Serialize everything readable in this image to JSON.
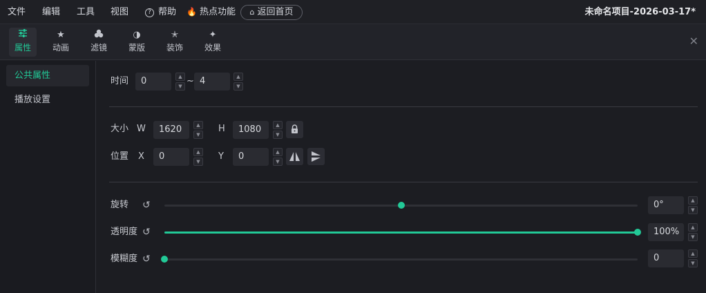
{
  "colors": {
    "accent": "#22c997",
    "background": "#1c1d22",
    "title_text": "#e6e7ea"
  },
  "menu": {
    "file": "文件",
    "edit": "编辑",
    "tools": "工具",
    "view": "视图",
    "help": "帮助",
    "hot_features": "热点功能",
    "home_button": "返回首页"
  },
  "project_title": "未命名项目-2026-03-17*",
  "tabs": [
    {
      "label": "属性",
      "icon": "sliders-icon",
      "active": true
    },
    {
      "label": "动画",
      "icon": "star-motion-icon"
    },
    {
      "label": "滤镜",
      "icon": "filter-circles-icon"
    },
    {
      "label": "蒙版",
      "icon": "mask-half-icon"
    },
    {
      "label": "装饰",
      "icon": "sparkle-star-icon"
    },
    {
      "label": "效果",
      "icon": "effects-sparkle-icon"
    }
  ],
  "sidebar": {
    "items": [
      {
        "label": "公共属性",
        "active": true
      },
      {
        "label": "播放设置"
      }
    ]
  },
  "time": {
    "label": "时间",
    "start": "0",
    "separator": "~",
    "end": "4"
  },
  "size": {
    "label": "大小",
    "w_label": "W",
    "w_value": "1620",
    "h_label": "H",
    "h_value": "1080",
    "lock_icon": "lock-icon"
  },
  "position": {
    "label": "位置",
    "x_label": "X",
    "x_value": "0",
    "y_label": "Y",
    "y_value": "0",
    "flip_h_icon": "flip-horizontal-icon",
    "flip_v_icon": "flip-vertical-icon"
  },
  "rotation": {
    "label": "旋转",
    "value_text": "0°",
    "value": 0,
    "min": -180,
    "max": 180
  },
  "opacity": {
    "label": "透明度",
    "value_text": "100%",
    "value": 100,
    "min": 0,
    "max": 100
  },
  "blur": {
    "label": "模糊度",
    "value_text": "0",
    "value": 0,
    "min": 0,
    "max": 100
  }
}
